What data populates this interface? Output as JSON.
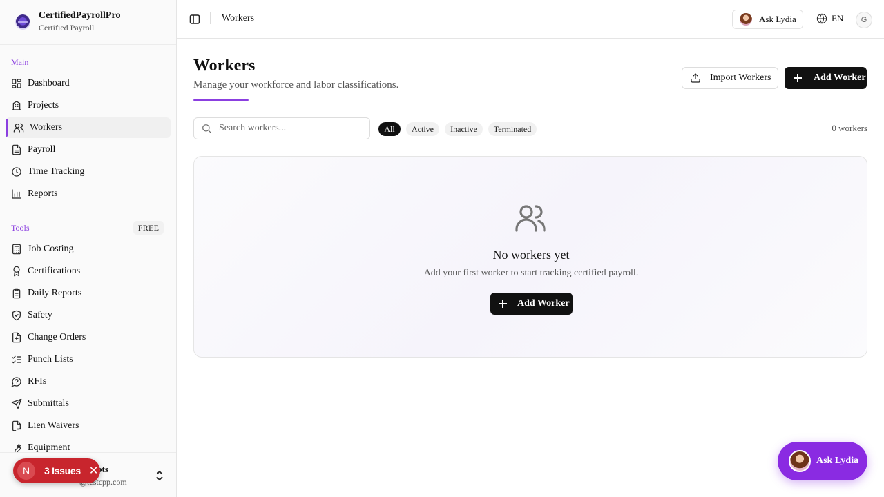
{
  "brand": {
    "name": "CertifiedPayrollPro",
    "subtitle": "Certified Payroll"
  },
  "sidebar": {
    "main_label": "Main",
    "main_items": [
      {
        "label": "Dashboard",
        "icon": "dashboard-icon"
      },
      {
        "label": "Projects",
        "icon": "building-icon"
      },
      {
        "label": "Workers",
        "icon": "users-icon",
        "active": true
      },
      {
        "label": "Payroll",
        "icon": "file-text-icon"
      },
      {
        "label": "Time Tracking",
        "icon": "clock-icon"
      },
      {
        "label": "Reports",
        "icon": "bar-chart-icon"
      }
    ],
    "tools_label": "Tools",
    "tools_badge": "FREE",
    "tools_items": [
      {
        "label": "Job Costing",
        "icon": "calculator-icon"
      },
      {
        "label": "Certifications",
        "icon": "award-icon"
      },
      {
        "label": "Daily Reports",
        "icon": "clipboard-icon"
      },
      {
        "label": "Safety",
        "icon": "shield-check-icon"
      },
      {
        "label": "Change Orders",
        "icon": "file-diff-icon"
      },
      {
        "label": "Punch Lists",
        "icon": "list-checks-icon"
      },
      {
        "label": "RFIs",
        "icon": "help-circle-icon"
      },
      {
        "label": "Submittals",
        "icon": "send-icon"
      },
      {
        "label": "Lien Waivers",
        "icon": "file-signature-icon"
      },
      {
        "label": "Equipment",
        "icon": "wrench-icon"
      }
    ],
    "footer": {
      "name": "ots",
      "email": "@testcpp.com"
    }
  },
  "issues": {
    "initial": "N",
    "label": "3 Issues"
  },
  "topbar": {
    "breadcrumb": "Workers",
    "ask_label": "Ask Lydia",
    "lang": "EN",
    "user_initial": "G"
  },
  "page": {
    "title": "Workers",
    "subtitle": "Manage your workforce and labor classifications.",
    "import_label": "Import Workers",
    "add_label": "Add Worker",
    "search_placeholder": "Search workers...",
    "filters": [
      "All",
      "Active",
      "Inactive",
      "Terminated"
    ],
    "active_filter": "All",
    "count": "0 workers"
  },
  "empty": {
    "title": "No workers yet",
    "description": "Add your first worker to start tracking certified payroll.",
    "button_label": "Add Worker"
  },
  "fab": {
    "label": "Ask Lydia"
  },
  "colors": {
    "accent": "#8b3fe0",
    "fab": "#8a2be2",
    "issues": "#c8252d"
  }
}
